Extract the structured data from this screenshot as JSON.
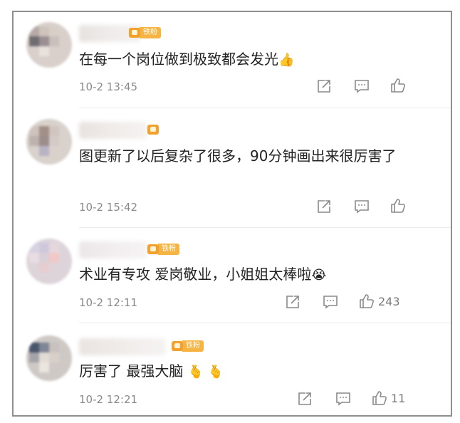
{
  "comments": [
    {
      "badge": "铁粉",
      "text": "在每一个岗位做到极致都会发光",
      "emoji": "👍",
      "time": "10-2 13:45",
      "likes": ""
    },
    {
      "badge": "",
      "text": "图更新了以后复杂了很多，90分钟画出来很厉害了",
      "emoji": "",
      "time": "10-2 15:42",
      "likes": ""
    },
    {
      "badge": "铁粉",
      "text": "术业有专攻 爱岗敬业，小姐姐太棒啦",
      "emoji": "😭",
      "time": "10-2 12:11",
      "likes": "243"
    },
    {
      "badge": "铁粉",
      "text": "厉害了 最强大脑",
      "emoji": "🫰 🫰",
      "time": "10-2 12:21",
      "likes": "11"
    }
  ],
  "icons": {
    "share": "share-icon",
    "comment": "comment-icon",
    "like": "like-icon"
  },
  "colors": {
    "text": "#222222",
    "meta": "#8a8a8a",
    "badge": "#f6b443",
    "frame": "#8f8f8f"
  }
}
